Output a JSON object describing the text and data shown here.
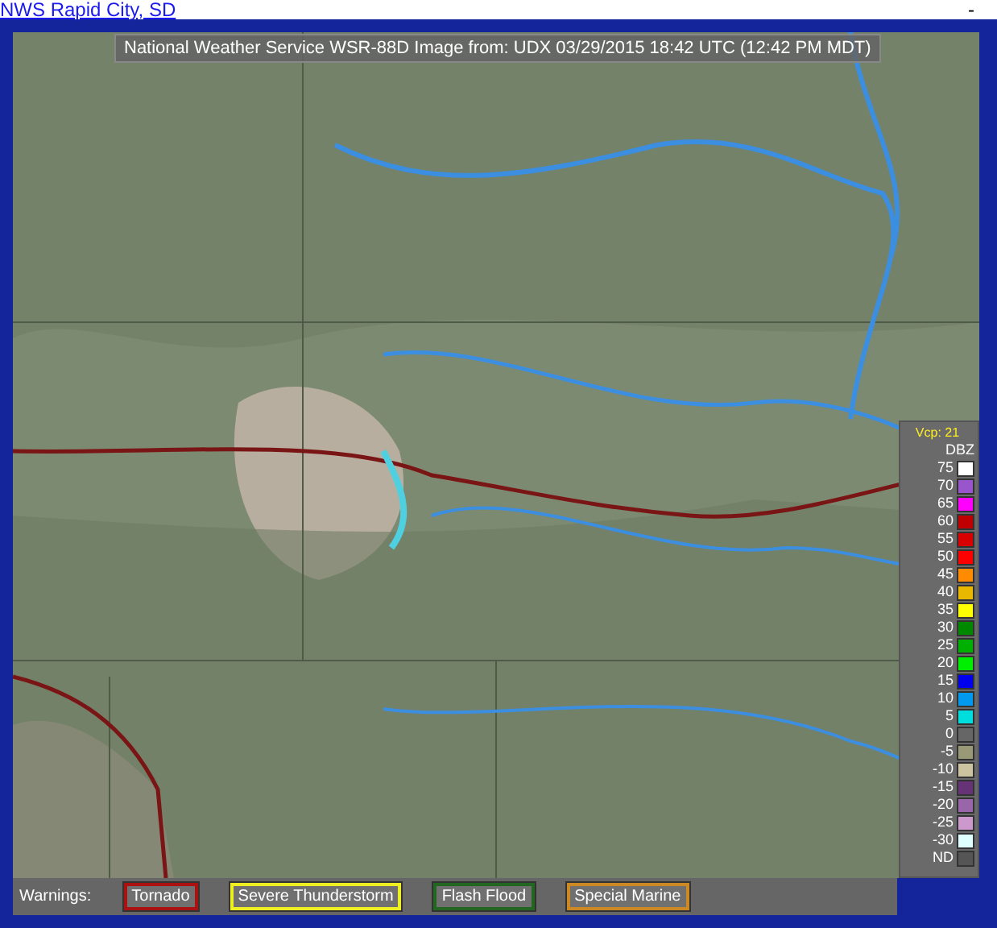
{
  "header_link": "NWS Rapid City, SD",
  "header_right": "-",
  "map": {
    "kind": "picture",
    "caption": "National Weather Service WSR-88D Image from: UDX 03/29/2015 18:42 UTC (12:42 PM MDT)"
  },
  "legend": {
    "vcp": "Vcp: 21",
    "unit": "DBZ",
    "levels": [
      {
        "label": "75",
        "color": "#ffffff"
      },
      {
        "label": "70",
        "color": "#9955cc"
      },
      {
        "label": "65",
        "color": "#ff00ff"
      },
      {
        "label": "60",
        "color": "#c00000"
      },
      {
        "label": "55",
        "color": "#d80000"
      },
      {
        "label": "50",
        "color": "#ff0000"
      },
      {
        "label": "45",
        "color": "#ff8c00"
      },
      {
        "label": "40",
        "color": "#e8b800"
      },
      {
        "label": "35",
        "color": "#ffff00"
      },
      {
        "label": "30",
        "color": "#008800"
      },
      {
        "label": "25",
        "color": "#00b000"
      },
      {
        "label": "20",
        "color": "#00ee00"
      },
      {
        "label": "15",
        "color": "#0000ee"
      },
      {
        "label": "10",
        "color": "#0099ee"
      },
      {
        "label": "5",
        "color": "#00dddd"
      },
      {
        "label": "0",
        "color": "#666666"
      },
      {
        "label": "-5",
        "color": "#999977"
      },
      {
        "label": "-10",
        "color": "#ccc4a0"
      },
      {
        "label": "-15",
        "color": "#663377"
      },
      {
        "label": "-20",
        "color": "#9966aa"
      },
      {
        "label": "-25",
        "color": "#cc99cc"
      },
      {
        "label": "-30",
        "color": "#ddffff"
      },
      {
        "label": "ND",
        "color": "#555555"
      }
    ]
  },
  "warnings": {
    "label": "Warnings:",
    "items": [
      {
        "label": "Tornado",
        "color": "#aa1111"
      },
      {
        "label": "Severe Thunderstorm",
        "color": "#eeee22"
      },
      {
        "label": "Flash Flood",
        "color": "#226622"
      },
      {
        "label": "Special Marine",
        "color": "#cc8822"
      }
    ]
  }
}
